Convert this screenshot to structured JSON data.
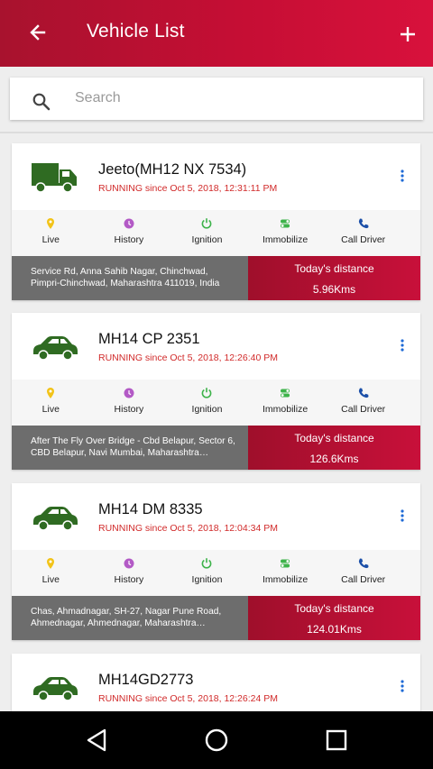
{
  "app_bar": {
    "title": "Vehicle List",
    "back_icon": "arrow-left-icon",
    "add_icon": "plus-icon",
    "color": "#c50e34"
  },
  "search": {
    "placeholder": "Search",
    "value": "",
    "icon": "search-icon"
  },
  "action_labels": {
    "live": "Live",
    "history": "History",
    "ignition": "Ignition",
    "immobilize": "Immobilize",
    "call_driver": "Call Driver"
  },
  "action_colors": {
    "live": "#f2c318",
    "history": "#b35ac6",
    "ignition": "#3db34a",
    "immobilize": "#3db34a",
    "call_driver": "#1b4fa8"
  },
  "vehicles": [
    {
      "name": "Jeeto(MH12 NX 7534)",
      "status": "RUNNING since Oct 5, 2018, 12:31:11 PM",
      "vehicle_icon": "truck-icon",
      "address": "Service Rd, Anna Sahib Nagar, Chinchwad, Pimpri-Chinchwad, Maharashtra 411019, India",
      "distance_label": "Today's distance",
      "distance_value": "5.96Kms"
    },
    {
      "name": "MH14 CP 2351",
      "status": "RUNNING since Oct 5, 2018, 12:26:40 PM",
      "vehicle_icon": "car-icon",
      "address": "After The Fly Over Bridge - Cbd Belapur, Sector 6, CBD Belapur, Navi Mumbai, Maharashtra…",
      "distance_label": "Today's distance",
      "distance_value": "126.6Kms"
    },
    {
      "name": "MH14 DM 8335",
      "status": "RUNNING since Oct 5, 2018, 12:04:34 PM",
      "vehicle_icon": "car-icon",
      "address": "Chas, Ahmadnagar, SH-27, Nagar Pune Road, Ahmednagar, Ahmednagar, Maharashtra…",
      "distance_label": "Today's distance",
      "distance_value": "124.01Kms"
    },
    {
      "name": "MH14GD2773",
      "status": "RUNNING since Oct 5, 2018, 12:26:24 PM",
      "vehicle_icon": "car-icon"
    }
  ],
  "status_color": "#d12a2a",
  "vehicle_icon_color": "#2f6b22",
  "nav_bar": {
    "back_icon": "triangle-back-icon",
    "home_icon": "circle-home-icon",
    "recents_icon": "square-recents-icon"
  }
}
